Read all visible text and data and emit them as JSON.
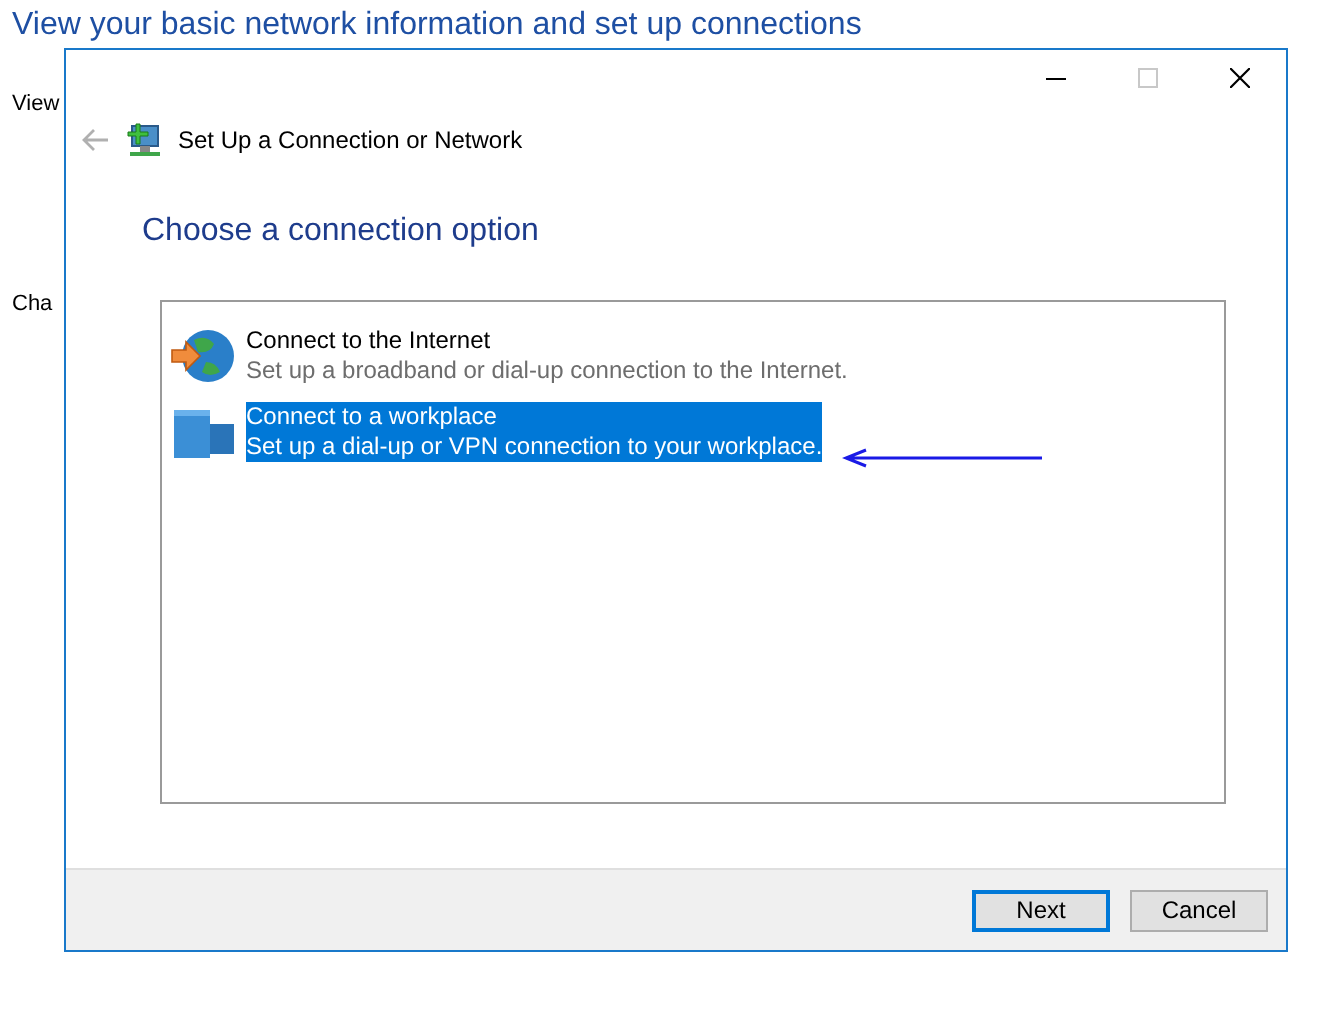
{
  "background_window": {
    "heading": "View your basic network information and set up connections",
    "labels": [
      "View",
      "Cha"
    ]
  },
  "dialog": {
    "title": "Set Up a Connection or Network",
    "heading": "Choose a connection option",
    "options": [
      {
        "kind": "internet",
        "title": "Connect to the Internet",
        "description": "Set up a broadband or dial-up connection to the Internet.",
        "selected": false
      },
      {
        "kind": "workplace",
        "title": "Connect to a workplace",
        "description": "Set up a dial-up or VPN connection to your workplace.",
        "selected": true
      }
    ],
    "buttons": [
      {
        "label": "Next",
        "default": true
      },
      {
        "label": "Cancel",
        "default": false
      }
    ]
  }
}
